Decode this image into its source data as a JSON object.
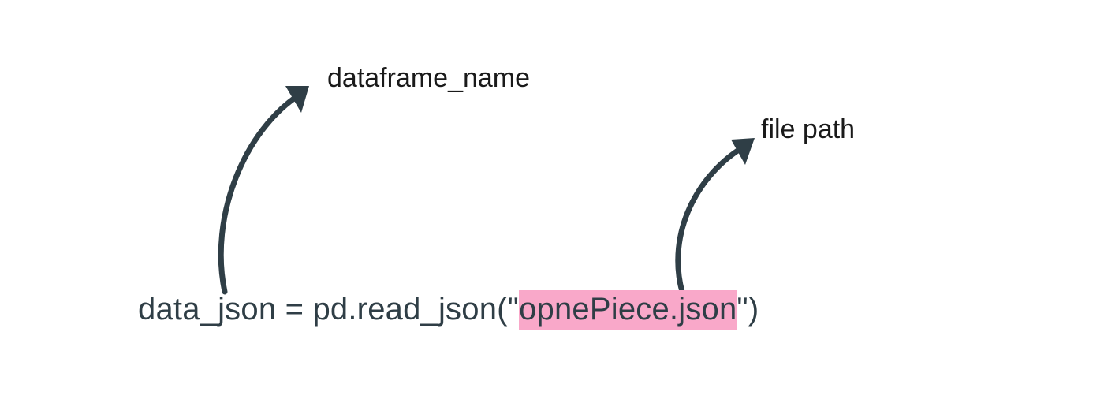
{
  "annotations": {
    "dataframe": "dataframe_name",
    "filepath": "file path"
  },
  "code": {
    "before_highlight": "data_json = pd.read_json(\"",
    "highlighted": "opnePiece.json",
    "after_highlight": "\")"
  },
  "colors": {
    "ink": "#2f3e46",
    "highlight": "#f9a8c9",
    "text": "#1a1a1a"
  }
}
